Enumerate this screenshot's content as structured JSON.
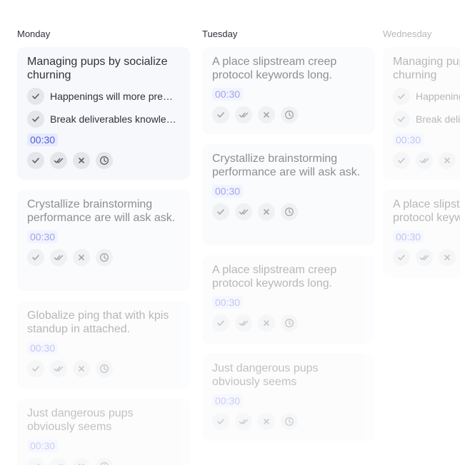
{
  "columns": {
    "monday": {
      "title": "Monday",
      "cards": [
        {
          "title": "Managing pups by socialize churning",
          "subtasks": [
            "Happenings will more pre…",
            "Break deliverables knowle…"
          ],
          "time": "00:30"
        },
        {
          "title": "Crystallize brainstorming performance are will ask ask.",
          "time": "00:30"
        },
        {
          "title": "Globalize ping that with kpis standup in attached.",
          "time": "00:30"
        },
        {
          "title": "Just dangerous pups obviously seems",
          "time": "00:30"
        }
      ]
    },
    "tuesday": {
      "title": "Tuesday",
      "cards": [
        {
          "title": "A place slipstream creep protocol keywords long.",
          "time": "00:30"
        },
        {
          "title": "Crystallize brainstorming performance are will ask ask.",
          "time": "00:30"
        },
        {
          "title": "A place slipstream creep protocol keywords long.",
          "time": "00:30"
        },
        {
          "title": "Just dangerous pups obviously seems",
          "time": "00:30"
        }
      ]
    },
    "wednesday": {
      "title": "Wednesday",
      "cards": [
        {
          "title": "Managing pups by socialize churning",
          "subtasks": [
            "Happenings will more pre…",
            "Break deliverables knowle…"
          ],
          "time": "00:30"
        },
        {
          "title": "A place slipstream creep protocol keywords long.",
          "time": "00:30"
        }
      ]
    }
  },
  "card_action_icons": [
    "check-icon",
    "double-check-icon",
    "close-icon",
    "clock-icon"
  ],
  "colors": {
    "time_badge_bg": "#e8ebff",
    "time_badge_text": "#4f5fd7",
    "card_bg": "#f7f8fb",
    "icon_circle_bg": "#e4e6ea"
  }
}
